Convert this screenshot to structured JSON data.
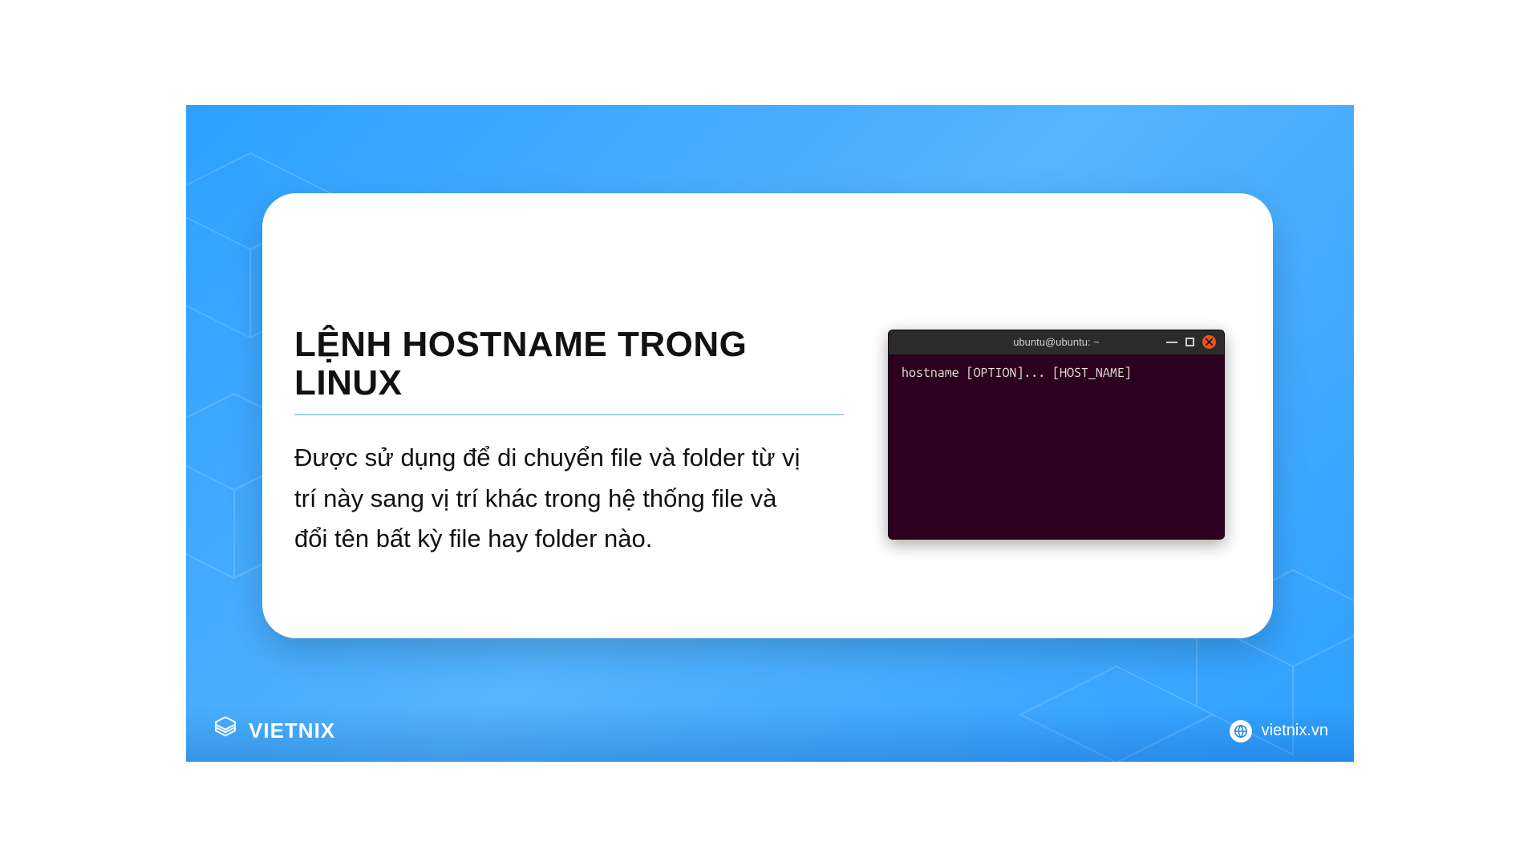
{
  "slide": {
    "title": "LỆNH HOSTNAME TRONG LINUX",
    "body": "Được sử dụng để di chuyển file và folder từ vị trí này sang vị trí khác trong hệ thống file và đổi tên bất kỳ file hay folder nào."
  },
  "terminal": {
    "title": "ubuntu@ubuntu: ~",
    "command": "hostname [OPTION]... [HOST_NAME]"
  },
  "footer": {
    "brand": "VIETNIX",
    "site": "vietnix.vn"
  }
}
